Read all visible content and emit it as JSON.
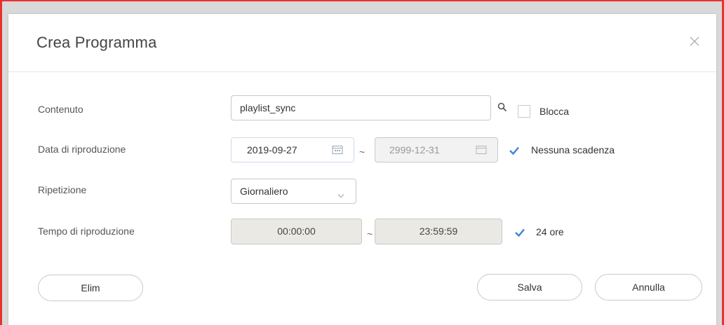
{
  "dialog": {
    "title": "Crea Programma"
  },
  "form": {
    "content": {
      "label": "Contenuto",
      "value": "playlist_sync",
      "lock_label": "Blocca",
      "lock_checked": false
    },
    "play_date": {
      "label": "Data di riproduzione",
      "start": "2019-09-27",
      "separator": "~",
      "end": "2999-12-31",
      "no_expiry_label": "Nessuna scadenza",
      "no_expiry_checked": true
    },
    "repeat": {
      "label": "Ripetizione",
      "selected": "Giornaliero"
    },
    "play_time": {
      "label": "Tempo di riproduzione",
      "start": "00:00:00",
      "separator": "~",
      "end": "23:59:59",
      "all_day_label": "24 ore",
      "all_day_checked": true
    }
  },
  "buttons": {
    "delete": "Elim",
    "save": "Salva",
    "cancel": "Annulla"
  },
  "icons": {
    "close": "close-icon",
    "search": "search-icon",
    "calendar": "calendar-icon",
    "chevron": "chevron-down-icon",
    "check": "check-icon"
  },
  "colors": {
    "accent": "#3a86d8",
    "frame": "#e8322f"
  }
}
